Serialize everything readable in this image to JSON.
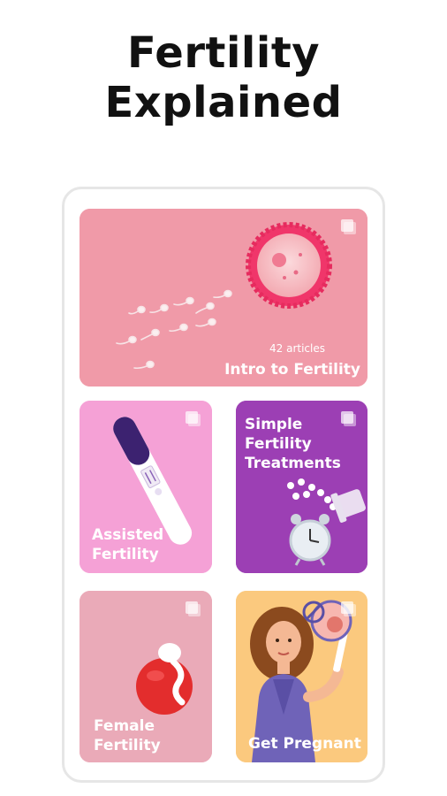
{
  "page": {
    "title_line1": "Fertility",
    "title_line2": "Explained"
  },
  "cards": [
    {
      "id": "intro",
      "label": "Intro to Fertility",
      "count": "42 articles",
      "color": "#f09aa8",
      "icon": "copy-icon"
    },
    {
      "id": "assisted",
      "label_line1": "Assisted",
      "label_line2": "Fertility",
      "color": "#f5a1d6",
      "icon": "copy-icon"
    },
    {
      "id": "simple",
      "label_line1": "Simple",
      "label_line2": "Fertility",
      "label_line3": "Treatments",
      "color": "#9c3fb4",
      "icon": "copy-icon"
    },
    {
      "id": "female",
      "label_line1": "Female",
      "label_line2": "Fertility",
      "color": "#eaaab8",
      "icon": "copy-icon"
    },
    {
      "id": "pregnant",
      "label": "Get Pregnant",
      "color": "#fbc97e",
      "icon": "copy-icon"
    }
  ]
}
